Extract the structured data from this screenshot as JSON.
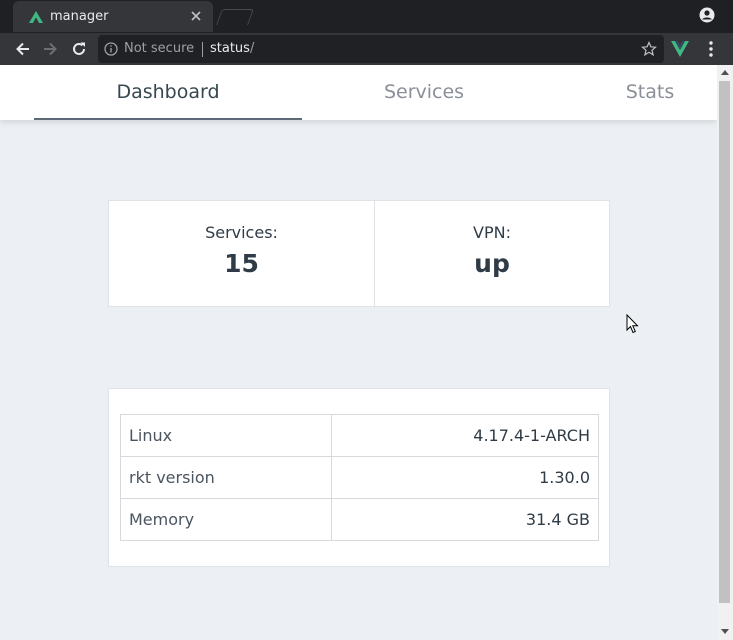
{
  "browser": {
    "tab_title": "manager",
    "security_label": "Not secure",
    "url_host": "status",
    "url_path": "/",
    "icons": [
      "nuxt-favicon-icon",
      "close-icon",
      "profile-icon",
      "back-icon",
      "forward-icon",
      "reload-icon",
      "info-icon",
      "star-icon",
      "vue-devtools-icon",
      "menu-icon"
    ]
  },
  "nav": {
    "tabs": [
      {
        "label": "Dashboard",
        "active": true
      },
      {
        "label": "Services",
        "active": false
      },
      {
        "label": "Stats",
        "active": false
      }
    ]
  },
  "stats": [
    {
      "label": "Services:",
      "value": "15"
    },
    {
      "label": "VPN:",
      "value": "up"
    }
  ],
  "system_info": {
    "rows": [
      {
        "key": "Linux",
        "value": "4.17.4-1-ARCH"
      },
      {
        "key": "rkt version",
        "value": "1.30.0"
      },
      {
        "key": "Memory",
        "value": "31.4 GB"
      }
    ]
  },
  "colors": {
    "accent_green": "#41b883",
    "page_background": "#eceff3",
    "chrome_dark": "#35363a"
  }
}
